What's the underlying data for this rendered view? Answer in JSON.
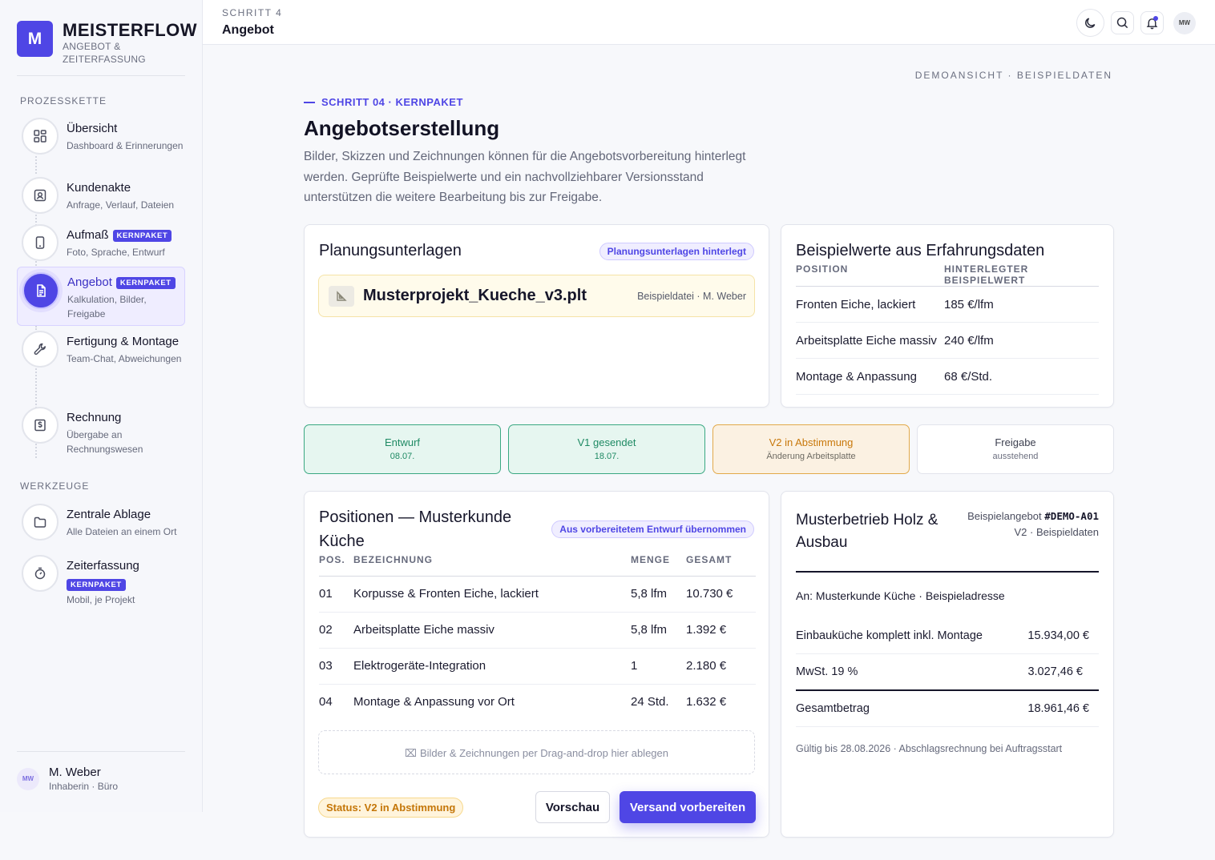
{
  "brand": {
    "logo_letter": "M",
    "name": "MEISTERFLOW",
    "subtitle": "ANGEBOT & ZEITERFASSUNG"
  },
  "sidebar": {
    "section_process": "PROZESSKETTE",
    "section_tools": "WERKZEUGE",
    "items": [
      {
        "title": "Übersicht",
        "desc": "Dashboard & Erinnerungen",
        "icon": "dashboard-icon"
      },
      {
        "title": "Kundenakte",
        "desc": "Anfrage, Verlauf, Dateien",
        "icon": "contact-icon"
      },
      {
        "title": "Aufmaß",
        "badge": "KERNPAKET",
        "desc": "Foto, Sprache, Entwurf",
        "icon": "tablet-icon"
      },
      {
        "title": "Angebot",
        "badge": "KERNPAKET",
        "desc": "Kalkulation, Bilder, Freigabe",
        "icon": "document-icon",
        "active": true
      },
      {
        "title": "Fertigung & Montage",
        "desc": "Team-Chat, Abweichungen",
        "icon": "wrench-icon"
      },
      {
        "title": "Rechnung",
        "desc": "Übergabe an Rechnungswesen",
        "icon": "invoice-icon"
      }
    ],
    "tools": [
      {
        "title": "Zentrale Ablage",
        "desc": "Alle Dateien an einem Ort",
        "icon": "folder-icon"
      },
      {
        "title": "Zeiterfassung",
        "badge": "KERNPAKET",
        "desc": "Mobil, je Projekt",
        "icon": "stopwatch-icon"
      }
    ],
    "user": {
      "initials": "MW",
      "name": "M. Weber",
      "role": "Inhaberin · Büro"
    }
  },
  "topbar": {
    "step": "SCHRITT 4",
    "title": "Angebot",
    "avatar": "MW"
  },
  "main": {
    "demo_note": "DEMOANSICHT · BEISPIELDATEN",
    "eyebrow": "SCHRITT 04 · KERNPAKET",
    "title": "Angebotserstellung",
    "intro": "Bilder, Skizzen und Zeichnungen können für die Angebotsvorbereitung hinterlegt werden. Geprüfte Beispielwerte und ein nachvollziehbarer Versionsstand unterstützen die weitere Bearbeitung bis zur Freigabe."
  },
  "planning": {
    "title": "Planungsunterlagen",
    "pill": "Planungsunterlagen hinterlegt",
    "file_name": "Musterprojekt_Kueche_v3.plt",
    "file_meta": "Beispieldatei · M. Weber"
  },
  "reference": {
    "title": "Beispielwerte aus Erfahrungsdaten",
    "col_position": "POSITION",
    "col_value": "HINTERLEGTER BEISPIELWERT",
    "rows": [
      {
        "position": "Fronten Eiche, lackiert",
        "value": "185 €/lfm"
      },
      {
        "position": "Arbeitsplatte Eiche massiv",
        "value": "240 €/lfm"
      },
      {
        "position": "Montage & Anpassung",
        "value": "68 €/Std."
      }
    ]
  },
  "versions": [
    {
      "label": "Entwurf",
      "sub": "08.07.",
      "state": "done"
    },
    {
      "label": "V1 gesendet",
      "sub": "18.07.",
      "state": "done"
    },
    {
      "label": "V2 in Abstimmung",
      "sub": "Änderung Arbeitsplatte",
      "state": "current"
    },
    {
      "label": "Freigabe",
      "sub": "ausstehend",
      "state": "pending"
    }
  ],
  "positions": {
    "title": "Positionen — Musterkunde Küche",
    "pill": "Aus vorbereitetem Entwurf übernommen",
    "col_pos": "POS.",
    "col_desc": "BEZEICHNUNG",
    "col_qty": "MENGE",
    "col_total": "GESAMT",
    "rows": [
      {
        "pos": "01",
        "desc": "Korpusse & Fronten Eiche, lackiert",
        "qty": "5,8 lfm",
        "total": "10.730 €"
      },
      {
        "pos": "02",
        "desc": "Arbeitsplatte Eiche massiv",
        "qty": "5,8 lfm",
        "total": "1.392 €"
      },
      {
        "pos": "03",
        "desc": "Elektrogeräte-Integration",
        "qty": "1",
        "total": "2.180 €"
      },
      {
        "pos": "04",
        "desc": "Montage & Anpassung vor Ort",
        "qty": "24 Std.",
        "total": "1.632 €"
      }
    ],
    "drop_text": "Bilder & Zeichnungen per Drag-and-drop hier ablegen",
    "status": "Status: V2 in Abstimmung",
    "preview_button": "Vorschau",
    "send_button": "Versand vorbereiten"
  },
  "offer": {
    "company": "Musterbetrieb Holz & Ausbau",
    "label": "Beispielangebot",
    "number": "#DEMO-A01",
    "version": "V2 · Beispieldaten",
    "recipient": "An: Musterkunde Küche · Beispieladresse",
    "lines": [
      {
        "label": "Einbauküche komplett inkl. Montage",
        "value": "15.934,00 €"
      },
      {
        "label": "MwSt. 19 %",
        "value": "3.027,46 €"
      }
    ],
    "total_label": "Gesamtbetrag",
    "total_value": "18.961,46 €",
    "footer": "Gültig bis 28.08.2026 · Abschlagsrechnung bei Auftragsstart"
  },
  "colors": {
    "accent": "#4f46e5",
    "done_bg": "#e6f6f0",
    "done_border": "#3aa882",
    "current_bg": "#fbf1e2",
    "current_border": "#e2a94a"
  }
}
